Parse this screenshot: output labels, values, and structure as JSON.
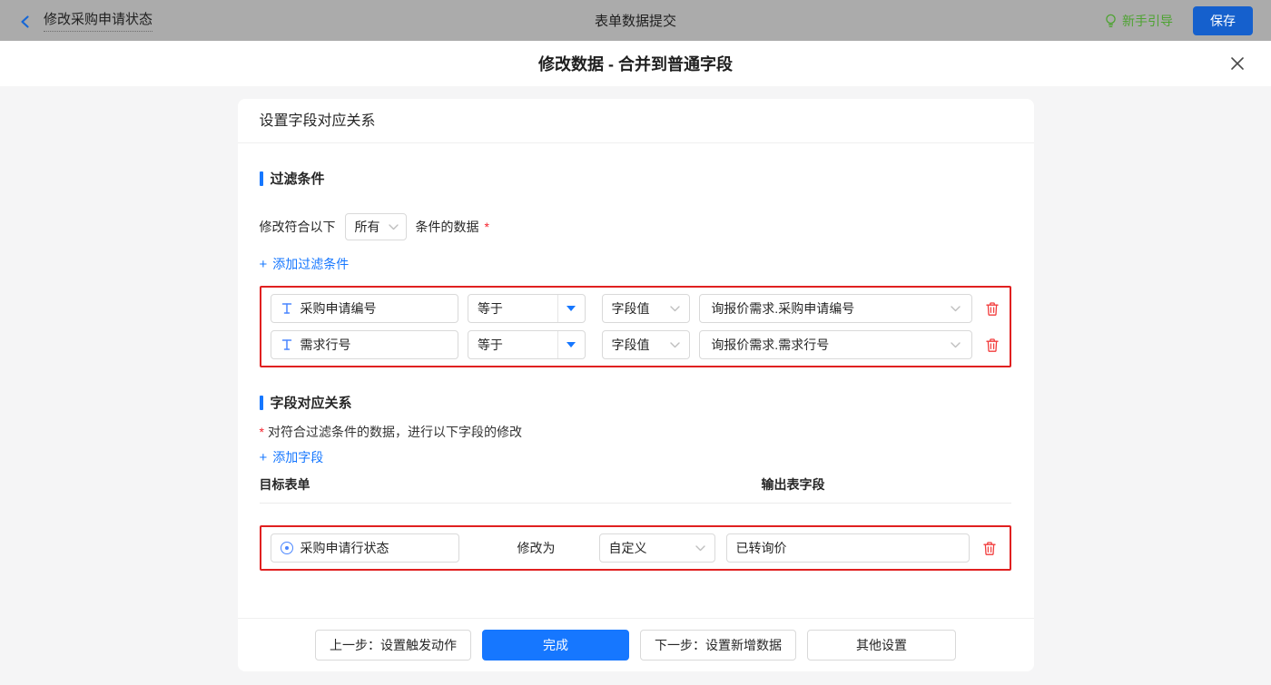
{
  "topbar": {
    "back_title": "修改采购申请状态",
    "center_title": "表单数据提交",
    "guide_label": "新手引导",
    "save_label": "保存"
  },
  "dialog": {
    "title": "修改数据 - 合并到普通字段",
    "close_icon": "close"
  },
  "panel": {
    "header": "设置字段对应关系",
    "filter_section": {
      "title": "过滤条件",
      "prefix": "修改符合以下",
      "match_select": "所有",
      "suffix": "条件的数据",
      "required_mark": "*",
      "plus": "+",
      "add_label": "添加过滤条件",
      "rows": [
        {
          "field": "采购申请编号",
          "operator": "等于",
          "value_type": "字段值",
          "value": "询报价需求.采购申请编号"
        },
        {
          "field": "需求行号",
          "operator": "等于",
          "value_type": "字段值",
          "value": "询报价需求.需求行号"
        }
      ]
    },
    "mapping_section": {
      "title": "字段对应关系",
      "required_mark": "*",
      "description": "对符合过滤条件的数据，进行以下字段的修改",
      "plus": "+",
      "add_label": "添加字段",
      "col_target": "目标表单",
      "col_output": "输出表字段",
      "rows": [
        {
          "field": "采购申请行状态",
          "action": "修改为",
          "mode": "自定义",
          "value": "已转询价"
        }
      ]
    },
    "footer": {
      "prev_label": "上一步：设置触发动作",
      "done_label": "完成",
      "next_label": "下一步：设置新增数据",
      "other_label": "其他设置"
    }
  },
  "icons": {
    "back": "chevron-left",
    "guide": "lightbulb",
    "close": "x",
    "text_field": "i-beam-text-cursor",
    "radio_field": "radio-circle",
    "select_chevron": "chevron-down",
    "operator_caret": "caret-down-filled",
    "delete": "trash"
  },
  "colors": {
    "accent_blue": "#1677ff",
    "save_blue": "#1560cd",
    "highlight_red": "#e02020",
    "trash_red": "#f23d3d",
    "guide_green": "#4ea332",
    "topbar_gray": "#ababab",
    "page_bg": "#f5f5f6"
  }
}
